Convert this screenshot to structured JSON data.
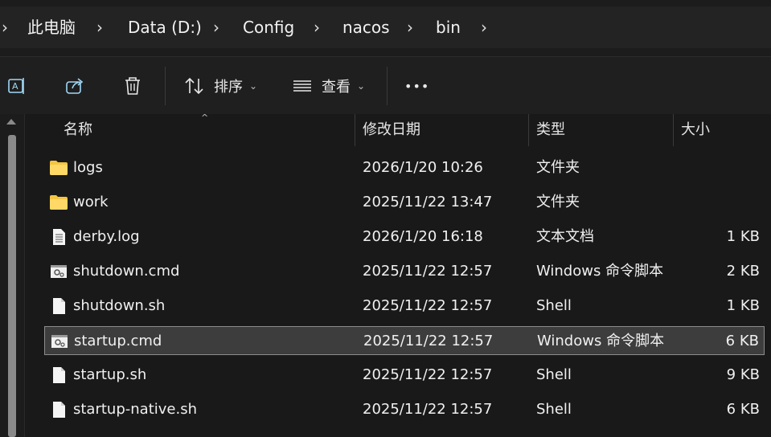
{
  "breadcrumb": {
    "items": [
      "此电脑",
      "Data (D:)",
      "Config",
      "nacos",
      "bin"
    ]
  },
  "toolbar": {
    "sort_label": "排序",
    "view_label": "查看",
    "more_label": "•••"
  },
  "columns": {
    "name": "名称",
    "modified": "修改日期",
    "type": "类型",
    "size": "大小"
  },
  "files": [
    {
      "name": "logs",
      "modified": "2026/1/20 10:26",
      "type": "文件夹",
      "size": "",
      "icon": "folder-icon"
    },
    {
      "name": "work",
      "modified": "2025/11/22 13:47",
      "type": "文件夹",
      "size": "",
      "icon": "folder-icon"
    },
    {
      "name": "derby.log",
      "modified": "2026/1/20 16:18",
      "type": "文本文档",
      "size": "1 KB",
      "icon": "text-file-icon"
    },
    {
      "name": "shutdown.cmd",
      "modified": "2025/11/22 12:57",
      "type": "Windows 命令脚本",
      "size": "2 KB",
      "icon": "cmd-file-icon"
    },
    {
      "name": "shutdown.sh",
      "modified": "2025/11/22 12:57",
      "type": "Shell",
      "size": "1 KB",
      "icon": "file-icon"
    },
    {
      "name": "startup.cmd",
      "modified": "2025/11/22 12:57",
      "type": "Windows 命令脚本",
      "size": "6 KB",
      "icon": "cmd-file-icon",
      "selected": true
    },
    {
      "name": "startup.sh",
      "modified": "2025/11/22 12:57",
      "type": "Shell",
      "size": "9 KB",
      "icon": "file-icon"
    },
    {
      "name": "startup-native.sh",
      "modified": "2025/11/22 12:57",
      "type": "Shell",
      "size": "6 KB",
      "icon": "file-icon"
    }
  ],
  "colors": {
    "folder": "#f4c542",
    "accent": "#60cdff",
    "selected_bg": "#3d3d3d"
  }
}
